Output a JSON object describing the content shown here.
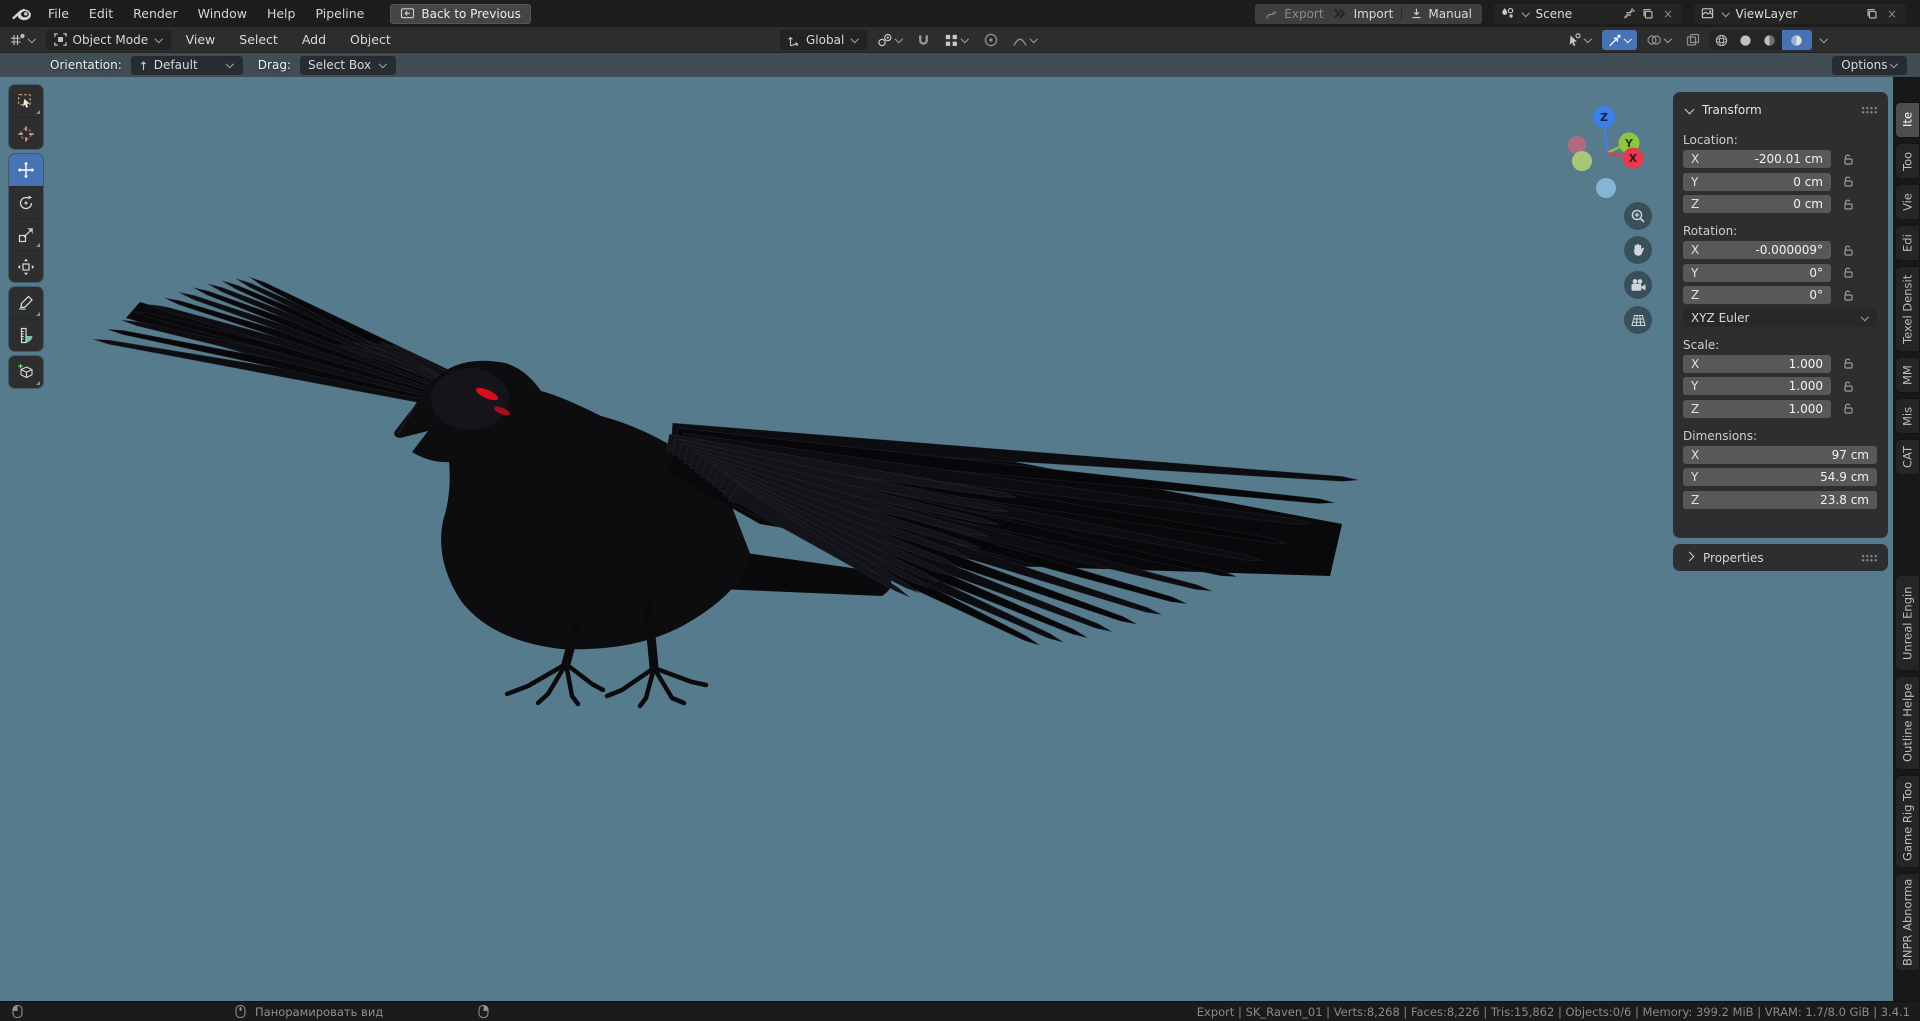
{
  "icons": {
    "close": "×"
  },
  "colors": {
    "accent": "#4772b3",
    "viewport_bg": "#567b8c",
    "axis_x": "#e8394f",
    "axis_y": "#8ec63f",
    "axis_z": "#3d7fe8",
    "raven_eye": "#d40f1e"
  },
  "topbar": {
    "menus": [
      "File",
      "Edit",
      "Render",
      "Window",
      "Help",
      "Pipeline"
    ],
    "back_button": "Back to Previous",
    "export_label": "Export",
    "import_label": "Import",
    "manual_label": "Manual",
    "scene_value": "Scene",
    "viewlayer_value": "ViewLayer"
  },
  "header": {
    "mode_value": "Object Mode",
    "menus": [
      "View",
      "Select",
      "Add",
      "Object"
    ],
    "orientation_value": "Global"
  },
  "toolstrip": {
    "orientation_label": "Orientation:",
    "orientation_value": "Default",
    "drag_label": "Drag:",
    "drag_value": "Select Box",
    "options_label": "Options"
  },
  "gizmo": {
    "x": "X",
    "y": "Y",
    "z": "Z"
  },
  "sidebar": {
    "transform": {
      "title": "Transform",
      "sections": [
        {
          "label": "Location:",
          "rows": [
            {
              "axis": "X",
              "value": "-200.01 cm"
            },
            {
              "axis": "Y",
              "value": "0 cm"
            },
            {
              "axis": "Z",
              "value": "0 cm"
            }
          ]
        },
        {
          "label": "Rotation:",
          "rows": [
            {
              "axis": "X",
              "value": "-0.000009°"
            },
            {
              "axis": "Y",
              "value": "0°"
            },
            {
              "axis": "Z",
              "value": "0°"
            }
          ],
          "mode": "XYZ Euler"
        },
        {
          "label": "Scale:",
          "rows": [
            {
              "axis": "X",
              "value": "1.000"
            },
            {
              "axis": "Y",
              "value": "1.000"
            },
            {
              "axis": "Z",
              "value": "1.000"
            }
          ]
        },
        {
          "label": "Dimensions:",
          "rows": [
            {
              "axis": "X",
              "value": "97 cm"
            },
            {
              "axis": "Y",
              "value": "54.9 cm"
            },
            {
              "axis": "Z",
              "value": "23.8 cm"
            }
          ]
        }
      ]
    },
    "properties_title": "Properties",
    "tabs": [
      {
        "label": "Ite"
      },
      {
        "label": "Too"
      },
      {
        "label": "Vie"
      },
      {
        "label": "Edi"
      },
      {
        "label": "Texel Densit"
      },
      {
        "label": "MM"
      },
      {
        "label": "Mis"
      },
      {
        "label": "CAT"
      },
      {
        "label": "Unreal Engin"
      },
      {
        "label": "Outline Helpe"
      },
      {
        "label": "Game Rig Too"
      },
      {
        "label": "BNPR Abnorma"
      }
    ]
  },
  "statusbar": {
    "pan_label": "Панорамировать вид",
    "stats": "Export | SK_Raven_01 | Verts:8,268 | Faces:8,226 | Tris:15,862 | Objects:0/6 | Memory: 399.2 MiB | VRAM: 1.7/8.0 GiB | 3.4.1"
  }
}
